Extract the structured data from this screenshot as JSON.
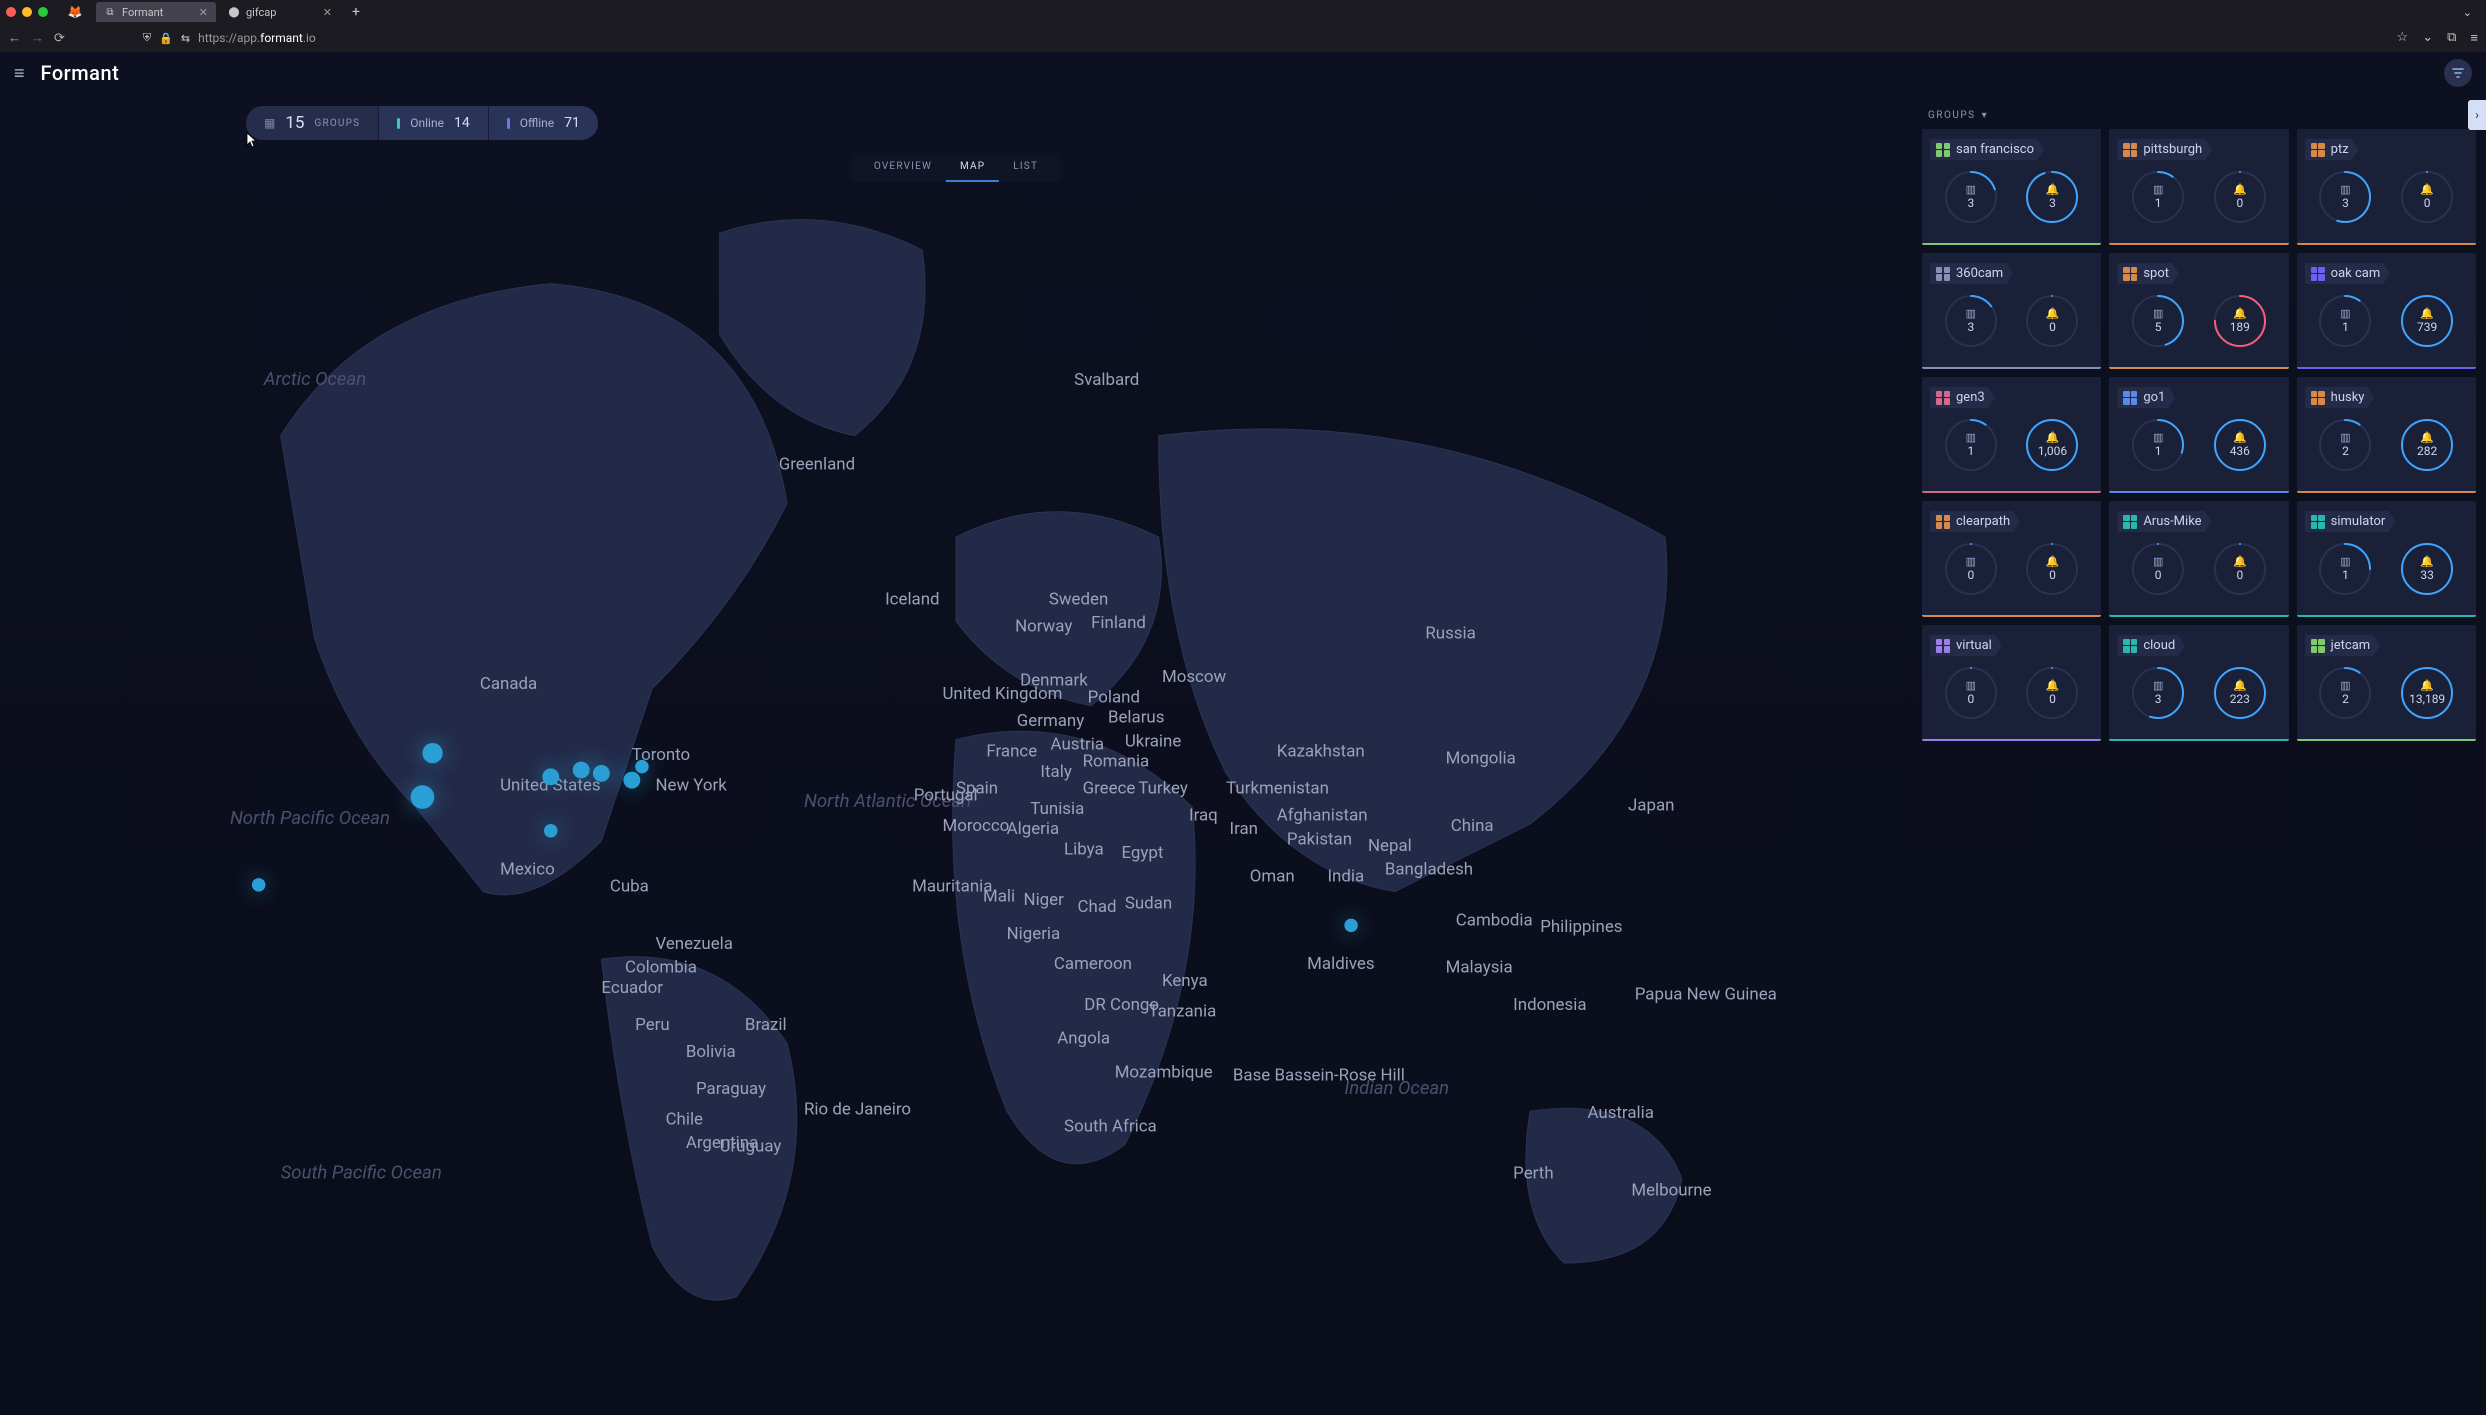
{
  "browser": {
    "tabs": [
      {
        "title": "Formant",
        "active": true
      },
      {
        "title": "gifcap",
        "active": false
      }
    ],
    "url_proto": "https://",
    "url_prefix": "app.",
    "url_domain": "formant",
    "url_suffix": ".io"
  },
  "app": {
    "brand": "Formant"
  },
  "stats": {
    "groups_count": "15",
    "groups_label": "GROUPS",
    "online_label": "Online",
    "online_count": "14",
    "offline_label": "Offline",
    "offline_count": "71"
  },
  "tabs": {
    "overview": "OVERVIEW",
    "map": "MAP",
    "list": "LIST"
  },
  "groups_header": "GROUPS",
  "map_labels": {
    "arctic": "Arctic Ocean",
    "natlantic": "North Atlantic Ocean",
    "npacific": "North Pacific Ocean",
    "spacific": "South Pacific Ocean",
    "indian": "Indian Ocean",
    "svalbard": "Svalbard",
    "greenland": "Greenland",
    "iceland": "Iceland",
    "sweden": "Sweden",
    "norway": "Norway",
    "finland": "Finland",
    "russia": "Russia",
    "uk": "United Kingdom",
    "denmark": "Denmark",
    "germany": "Germany",
    "poland": "Poland",
    "belarus": "Belarus",
    "ukraine": "Ukraine",
    "france": "France",
    "spain": "Spain",
    "portugal": "Portugal",
    "italy": "Italy",
    "austria": "Austria",
    "romania": "Romania",
    "greece": "Greece",
    "turkey": "Turkey",
    "kazakhstan": "Kazakhstan",
    "mongolia": "Mongolia",
    "china": "China",
    "japan": "Japan",
    "canada": "Canada",
    "toronto": "Toronto",
    "newyork": "New York",
    "us": "United States",
    "mexico": "Mexico",
    "cuba": "Cuba",
    "venezuela": "Venezuela",
    "colombia": "Colombia",
    "ecuador": "Ecuador",
    "peru": "Peru",
    "brazil": "Brazil",
    "bolivia": "Bolivia",
    "paraguay": "Paraguay",
    "chile": "Chile",
    "argentina": "Argentina",
    "uruguay": "Uruguay",
    "rio": "Rio de Janeiro",
    "morocco": "Morocco",
    "algeria": "Algeria",
    "tunisia": "Tunisia",
    "libya": "Libya",
    "egypt": "Egypt",
    "mauritania": "Mauritania",
    "mali": "Mali",
    "niger": "Niger",
    "chad": "Chad",
    "sudan": "Sudan",
    "nigeria": "Nigeria",
    "cameroon": "Cameroon",
    "drc": "DR Congo",
    "angola": "Angola",
    "tanzania": "Tanzania",
    "kenya": "Kenya",
    "mozambique": "Mozambique",
    "southafrica": "South Africa",
    "bassein": "Base Bassein-Rose Hill",
    "iran": "Iran",
    "iraq": "Iraq",
    "afghanistan": "Afghanistan",
    "pakistan": "Pakistan",
    "india": "India",
    "nepal": "Nepal",
    "bangladesh": "Bangladesh",
    "oman": "Oman",
    "turkmenistan": "Turkmenistan",
    "maldives": "Maldives",
    "cambodia": "Cambodia",
    "malaysia": "Malaysia",
    "indonesia": "Indonesia",
    "philippines": "Philippines",
    "png": "Papua New Guinea",
    "australia": "Australia",
    "perth": "Perth",
    "melbourne": "Melbourne",
    "moscow": "Moscow"
  },
  "groups": [
    {
      "name": "san francisco",
      "color": "#7fc96f",
      "devices": "3",
      "dev_pct": 20,
      "alerts": "3",
      "alert_pct": 95,
      "alert_style": "blue"
    },
    {
      "name": "pittsburgh",
      "color": "#d68a4a",
      "devices": "1",
      "dev_pct": 10,
      "alerts": "0",
      "alert_pct": 0,
      "alert_style": "blue"
    },
    {
      "name": "ptz",
      "color": "#d68a4a",
      "devices": "3",
      "dev_pct": 55,
      "alerts": "0",
      "alert_pct": 0,
      "alert_style": "blue"
    },
    {
      "name": "360cam",
      "color": "#8891b5",
      "devices": "3",
      "dev_pct": 15,
      "alerts": "0",
      "alert_pct": 0,
      "alert_style": "blue"
    },
    {
      "name": "spot",
      "color": "#d68a4a",
      "devices": "5",
      "dev_pct": 45,
      "alerts": "189",
      "alert_pct": 75,
      "alert_style": "red"
    },
    {
      "name": "oak cam",
      "color": "#6f5ff0",
      "devices": "1",
      "dev_pct": 10,
      "alerts": "739",
      "alert_pct": 100,
      "alert_style": "blue"
    },
    {
      "name": "gen3",
      "color": "#d46a8a",
      "devices": "1",
      "dev_pct": 10,
      "alerts": "1,006",
      "alert_pct": 100,
      "alert_style": "blue"
    },
    {
      "name": "go1",
      "color": "#5a8ae8",
      "devices": "1",
      "dev_pct": 30,
      "alerts": "436",
      "alert_pct": 100,
      "alert_style": "blue"
    },
    {
      "name": "husky",
      "color": "#d68a4a",
      "devices": "2",
      "dev_pct": 10,
      "alerts": "282",
      "alert_pct": 100,
      "alert_style": "blue"
    },
    {
      "name": "clearpath",
      "color": "#d68a4a",
      "devices": "0",
      "dev_pct": 0,
      "alerts": "0",
      "alert_pct": 0,
      "alert_style": "blue"
    },
    {
      "name": "Arus-Mike",
      "color": "#2ab7b0",
      "devices": "0",
      "dev_pct": 0,
      "alerts": "0",
      "alert_pct": 0,
      "alert_style": "blue"
    },
    {
      "name": "simulator",
      "color": "#2ab7b0",
      "devices": "1",
      "dev_pct": 25,
      "alerts": "33",
      "alert_pct": 100,
      "alert_style": "blue"
    },
    {
      "name": "virtual",
      "color": "#9a7fe8",
      "devices": "0",
      "dev_pct": 0,
      "alerts": "0",
      "alert_pct": 0,
      "alert_style": "blue"
    },
    {
      "name": "cloud",
      "color": "#2ab7b0",
      "devices": "3",
      "dev_pct": 55,
      "alerts": "223",
      "alert_pct": 100,
      "alert_style": "blue"
    },
    {
      "name": "jetcam",
      "color": "#7fc96f",
      "devices": "2",
      "dev_pct": 10,
      "alerts": "13,189",
      "alert_pct": 100,
      "alert_style": "blue"
    }
  ]
}
